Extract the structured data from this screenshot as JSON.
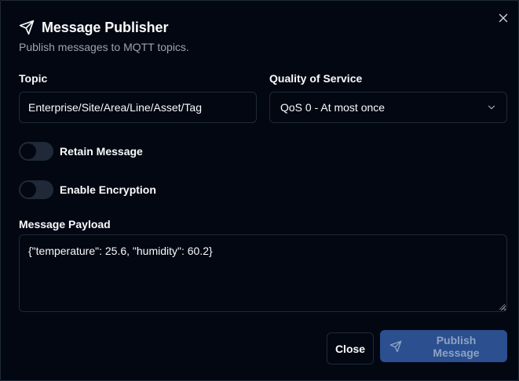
{
  "dialog": {
    "title": "Message Publisher",
    "subtitle": "Publish messages to MQTT topics.",
    "close_icon": "close-icon",
    "title_icon": "send-icon"
  },
  "form": {
    "topic_label": "Topic",
    "topic_value": "Enterprise/Site/Area/Line/Asset/Tag",
    "qos_label": "Quality of Service",
    "qos_value": "QoS 0 - At most once",
    "retain_label": "Retain Message",
    "retain_on": false,
    "encryption_label": "Enable Encryption",
    "encryption_on": false,
    "payload_label": "Message Payload",
    "payload_value": "{\"temperature\": 25.6, \"humidity\": 60.2}"
  },
  "actions": {
    "close_label": "Close",
    "publish_label": "Publish Message"
  },
  "colors": {
    "background": "#030712",
    "border": "#1f2937",
    "primary_disabled": "#2b4f8f",
    "muted_text": "#9ca3af"
  }
}
